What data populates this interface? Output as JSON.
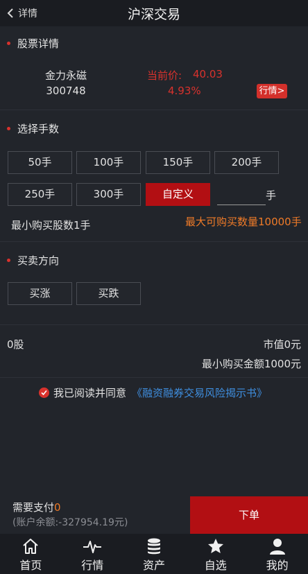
{
  "header": {
    "back_label": "详情",
    "title": "沪深交易"
  },
  "stock_section": {
    "title": "股票详情",
    "name": "金力永磁",
    "code": "300748",
    "price_label": "当前价:",
    "price": "40.03",
    "change_pct": "4.93%",
    "quote_button": "行情>"
  },
  "lots_section": {
    "title": "选择手数",
    "options": [
      "50手",
      "100手",
      "150手",
      "200手",
      "250手",
      "300手",
      "自定义"
    ],
    "selected": "自定义",
    "custom_value": "",
    "custom_unit": "手",
    "min_lots": "最小购买股数1手",
    "max_lots": "最大可购买数量10000手"
  },
  "direction_section": {
    "title": "买卖方向",
    "buy_up": "买涨",
    "buy_down": "买跌"
  },
  "summary": {
    "shares": "0股",
    "market_value": "市值0元",
    "min_amount": "最小购买金额1000元"
  },
  "agreement": {
    "text": "我已阅读并同意",
    "link": "《融资融券交易风险揭示书》"
  },
  "footer": {
    "pay_label": "需要支付",
    "pay_value": "0",
    "balance": "(账户余额:-327954.19元)",
    "order_button": "下单"
  },
  "tabbar": {
    "items": [
      "首页",
      "行情",
      "资产",
      "自选",
      "我的"
    ]
  },
  "colors": {
    "accent_red": "#b20f13",
    "price_red": "#d9322d",
    "orange": "#f07b28",
    "link_blue": "#3f8fe0",
    "background": "#22252b"
  }
}
